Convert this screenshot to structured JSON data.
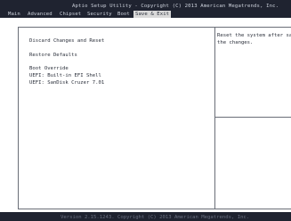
{
  "header": {
    "title": "Aptio Setup Utility - Copyright (C) 2013 American Megatrends, Inc."
  },
  "menu": {
    "tabs": [
      {
        "label": "Main"
      },
      {
        "label": "Advanced"
      },
      {
        "label": "Chipset"
      },
      {
        "label": "Security"
      },
      {
        "label": "Boot"
      },
      {
        "label": "Save & Exit",
        "active": true
      }
    ]
  },
  "main": {
    "options": [
      "Discard Changes and Reset",
      "Restore Defaults",
      "Boot Override",
      "UEFI: Built-in EFI Shell",
      "UEFI: SanDisk Cruzer 7.01"
    ]
  },
  "help": {
    "line1": "Reset the system after sav",
    "line2": "the changes."
  },
  "footer": {
    "text": "Version 2.15.1243. Copyright (C) 2013 American Megatrends, Inc."
  }
}
